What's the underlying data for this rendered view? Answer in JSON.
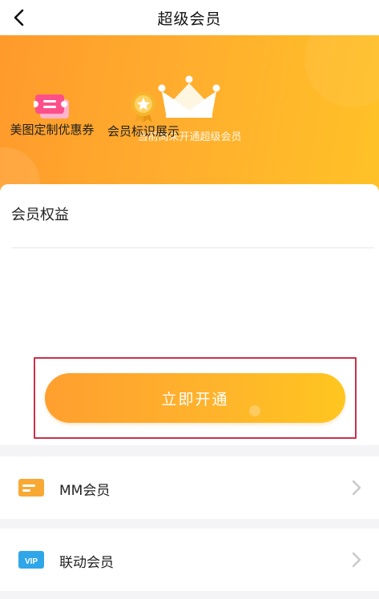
{
  "header": {
    "title": "超级会员",
    "back_icon": "chevron-left-icon"
  },
  "hero": {
    "status_text": "当前尚未开通超级会员",
    "icon": "crown-icon"
  },
  "benefits": {
    "title": "会员权益",
    "items": [
      {
        "label": "美图定制优惠券",
        "icon": "coupon-ticket-icon"
      },
      {
        "label": "会员标识展示",
        "icon": "star-medal-icon"
      }
    ],
    "cta_label": "立即开通"
  },
  "membership_rows": [
    {
      "label": "MM会员",
      "icon": "card-icon"
    },
    {
      "label": "联动会员",
      "icon": "vip-card-icon",
      "icon_text": "VIP"
    }
  ],
  "colors": {
    "accent_orange": "#ffad2e",
    "accent_yellow": "#ffc61f",
    "highlight_red": "#c8324a",
    "coupon_pink": "#ff4f8b"
  }
}
